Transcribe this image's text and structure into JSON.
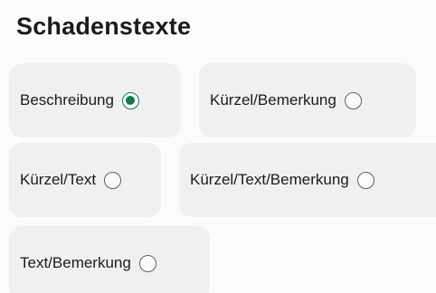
{
  "section": {
    "title": "Schadenstexte"
  },
  "options": [
    {
      "label": "Beschreibung",
      "selected": true
    },
    {
      "label": "Kürzel/Bemerkung",
      "selected": false
    },
    {
      "label": "Kürzel/Text",
      "selected": false
    },
    {
      "label": "Kürzel/Text/Bemerkung",
      "selected": false
    },
    {
      "label": "Text/Bemerkung",
      "selected": false
    }
  ],
  "colors": {
    "accent": "#0f7b4a",
    "option_background": "#f0f0f0",
    "page_background": "#fbfbfb"
  }
}
